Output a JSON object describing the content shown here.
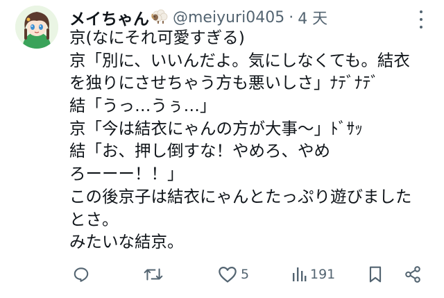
{
  "tweet": {
    "author": {
      "display_name": "メイちゃん",
      "name_emoji": "sheep-emoji",
      "handle": "@meiyuri0405",
      "separator": "·",
      "timestamp": "4 天",
      "avatar": "anime-girl-avatar"
    },
    "lines": [
      "京(なにそれ可愛すぎる)",
      "京「別に、いいんだよ。気にしなくても。結衣",
      "を独りにさせちゃう方も悪いしさ」ﾅﾃﾞﾅﾃﾞ",
      "結「うっ…うぅ…」",
      "京「今は結衣にゃんの方が大事〜」ﾄﾞｻｯ",
      "結「お、押し倒すな！やめろ、やめ",
      "ろーーー！！」",
      "この後京子は結衣にゃんとたっぷり遊びました",
      "とさ。",
      "みたいな結京。"
    ],
    "actions": {
      "reply": {
        "icon": "reply-icon",
        "count": ""
      },
      "repost": {
        "icon": "repost-icon",
        "count": ""
      },
      "like": {
        "icon": "heart-icon",
        "count": "5"
      },
      "views": {
        "icon": "views-icon",
        "count": "191"
      },
      "bookmark": {
        "icon": "bookmark-icon",
        "count": ""
      },
      "share": {
        "icon": "share-icon",
        "count": ""
      }
    },
    "more_icon": "more-vertical-icon"
  },
  "colors": {
    "text_primary": "#0f1419",
    "text_secondary": "#536471",
    "background": "#ffffff"
  }
}
